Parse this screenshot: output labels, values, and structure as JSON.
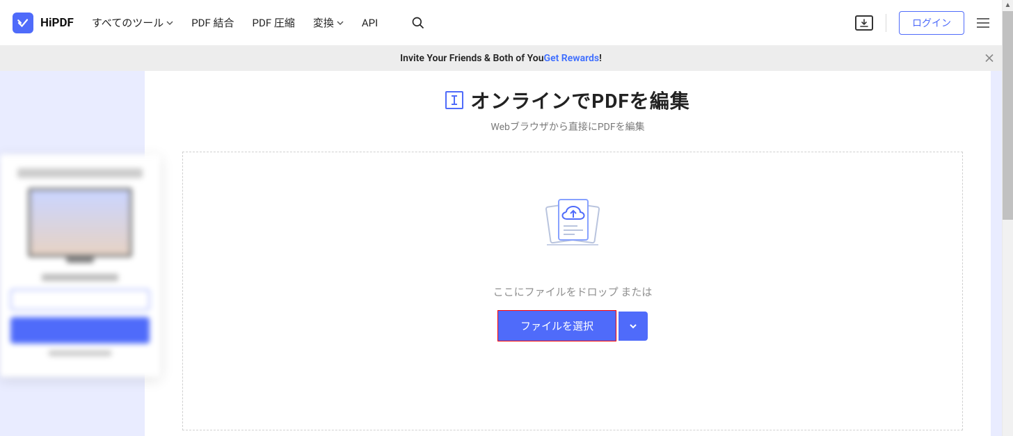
{
  "brand": "HiPDF",
  "nav": {
    "all_tools": "すべてのツール",
    "merge": "PDF 結合",
    "compress": "PDF 圧縮",
    "convert": "変換",
    "api": "API"
  },
  "header": {
    "login": "ログイン"
  },
  "promo": {
    "prefix": "Invite Your Friends & Both of You ",
    "link": "Get Rewards",
    "suffix": " !"
  },
  "page": {
    "title": "オンラインでPDFを編集",
    "subtitle": "Webブラウザから直接にPDFを編集",
    "drop_text": "ここにファイルをドロップ または",
    "choose_label": "ファイルを選択"
  }
}
